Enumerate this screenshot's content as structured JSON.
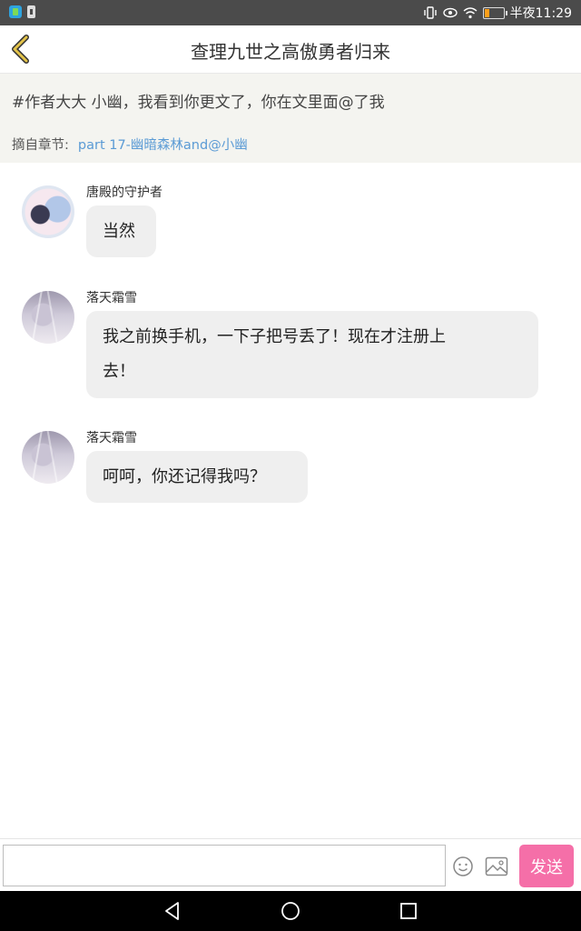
{
  "status_bar": {
    "time": "半夜11:29",
    "icons": [
      "app-notification-icon",
      "download-icon",
      "vibrate-icon",
      "eye-icon",
      "wifi-icon",
      "battery-icon"
    ],
    "battery_color": "#ff9f1a"
  },
  "header": {
    "back_icon": "chevron-left-icon",
    "back_color": "#e3c34a",
    "title": "查理九世之高傲勇者归来"
  },
  "quote": {
    "text": "#作者大大 小幽，我看到你更文了，你在文里面@了我",
    "excerpt_label": "摘自章节:",
    "excerpt_link": "part 17-幽暗森林and@小幽",
    "link_color": "#5b9bd5"
  },
  "messages": [
    {
      "sender": "唐殿的守护者",
      "text": "当然"
    },
    {
      "sender": "落天霜雪",
      "lines": [
        "我之前换手机，一下子把号丢了！现在才注册上",
        "去！"
      ]
    },
    {
      "sender": "落天霜雪",
      "text": "呵呵，你还记得我吗？"
    }
  ],
  "input_bar": {
    "placeholder": "",
    "emoji_icon": "smiley-icon",
    "image_icon": "image-icon",
    "send_label": "发送",
    "send_color": "#f56fa8"
  },
  "nav_bar": {
    "icons": [
      "back-triangle-icon",
      "home-circle-icon",
      "recents-square-icon"
    ]
  }
}
